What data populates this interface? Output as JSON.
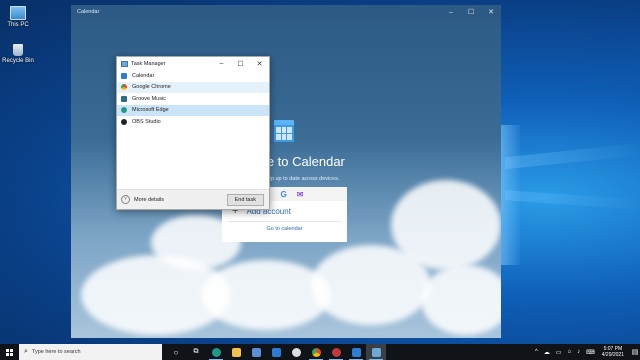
{
  "desktop": {
    "icons": [
      {
        "label": "This PC",
        "icon": "monitor-icon"
      },
      {
        "label": "Recycle Bin",
        "icon": "recycle-bin-icon"
      }
    ]
  },
  "calendar": {
    "title": "Calendar",
    "welcome": "me to Calendar",
    "subtitle": "keep up to date across devices.",
    "add_account": "Add account",
    "go_to_calendar": "Go to calendar"
  },
  "task_manager": {
    "title": "Task Manager",
    "processes": [
      {
        "name": "Calendar",
        "icon": "calendar-icon",
        "color": "#2a7fd4"
      },
      {
        "name": "Google Chrome",
        "icon": "chrome-icon",
        "color": "#e0a020"
      },
      {
        "name": "Groove Music",
        "icon": "groove-music-icon",
        "color": "#2b6e8c"
      },
      {
        "name": "Microsoft Edge",
        "icon": "edge-icon",
        "color": "#1f9a8a"
      },
      {
        "name": "OBS Studio",
        "icon": "obs-icon",
        "color": "#222222"
      }
    ],
    "more_details": "More details",
    "end_task": "End task"
  },
  "taskbar": {
    "search_placeholder": "Type here to search",
    "time": "5:07 PM",
    "date": "4/29/2021"
  },
  "colors": {
    "accent": "#0078d4",
    "taskbar": "#101418"
  }
}
